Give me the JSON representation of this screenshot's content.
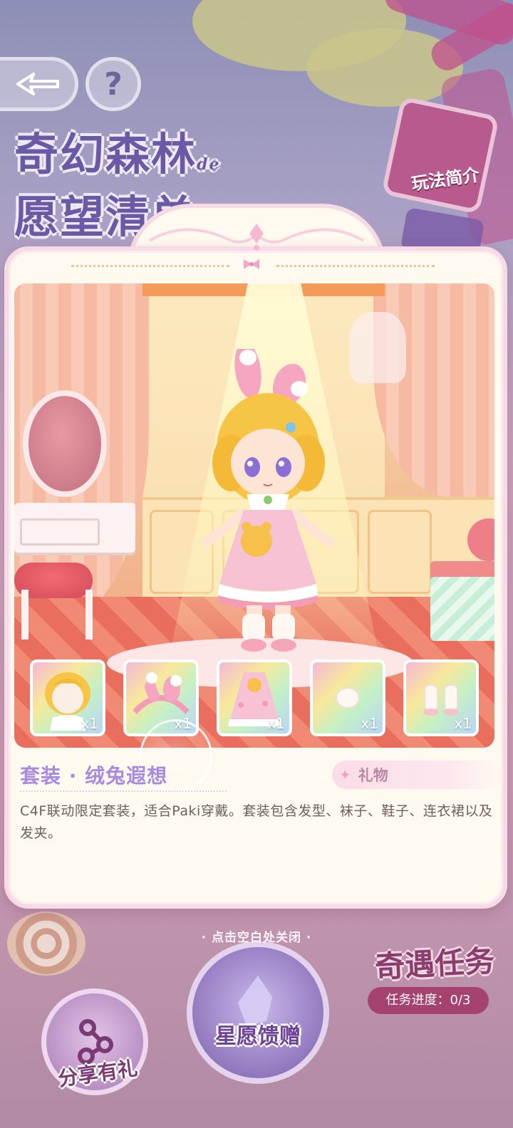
{
  "background": {
    "title_line1": "奇幻森林",
    "title_de": "de",
    "title_line2": "愿望清单",
    "intro_button_label": "玩法简介",
    "close_hint": "· 点击空白处关闭 ·",
    "task_title": "奇遇任务",
    "task_progress": "任务进度：0/3",
    "wish_gift_label": "星愿馈赠",
    "share_label": "分享有礼"
  },
  "dialog": {
    "item_title": "套装 · 绒兔遐想",
    "gift_tag_label": "礼物",
    "description": "C4F联动限定套装，适合Paki穿戴。套装包含发型、袜子、鞋子、连衣裙以及发夹。",
    "slots": [
      {
        "icon": "hairstyle-icon",
        "qty": "x1"
      },
      {
        "icon": "hairband-icon",
        "qty": "x1"
      },
      {
        "icon": "dress-icon",
        "qty": "x1"
      },
      {
        "icon": "socks-icon",
        "qty": "x1"
      },
      {
        "icon": "shoes-icon",
        "qty": "x1"
      }
    ]
  },
  "colors": {
    "dialog_bg": "#fffaf0",
    "title_purple": "#a88ae0",
    "text": "#6f605c",
    "tag_pink": "#fbdbe7"
  }
}
